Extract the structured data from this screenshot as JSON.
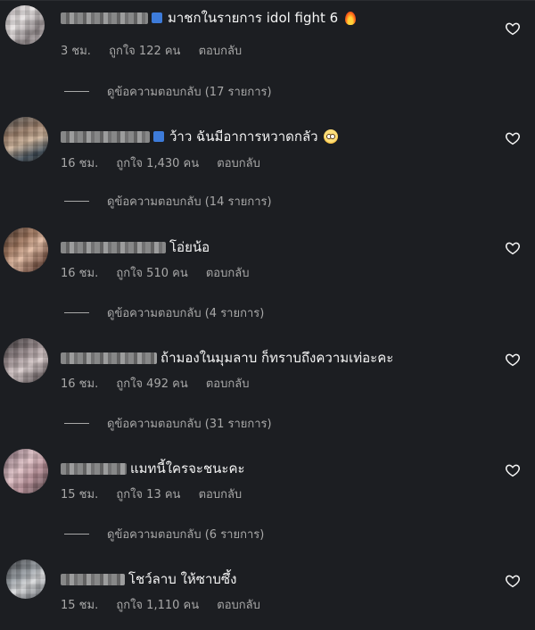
{
  "comments": [
    {
      "text": "มาชกในรายการ idol fight 6",
      "time": "3 ชม.",
      "likes": "ถูกใจ 122 คน",
      "reply": "ตอบกลับ",
      "view_replies": "ดูข้อความตอบกลับ (17 รายการ)",
      "emoji": "fire-icon"
    },
    {
      "text": "ว้าว ฉันมีอาการหวาดกลัว",
      "time": "16 ชม.",
      "likes": "ถูกใจ 1,430 คน",
      "reply": "ตอบกลับ",
      "view_replies": "ดูข้อความตอบกลับ (14 รายการ)",
      "emoji": "flushed-face-icon"
    },
    {
      "text": "โอ่ยน้อ",
      "time": "16 ชม.",
      "likes": "ถูกใจ 510 คน",
      "reply": "ตอบกลับ",
      "view_replies": "ดูข้อความตอบกลับ (4 รายการ)"
    },
    {
      "text": "ถ้ามองในมุมลาบ ก็ทราบถึงความเท่อะคะ",
      "time": "16 ชม.",
      "likes": "ถูกใจ 492 คน",
      "reply": "ตอบกลับ",
      "view_replies": "ดูข้อความตอบกลับ (31 รายการ)"
    },
    {
      "text": "แมทนี้ใครจะชนะคะ",
      "time": "15 ชม.",
      "likes": "ถูกใจ 13 คน",
      "reply": "ตอบกลับ",
      "view_replies": "ดูข้อความตอบกลับ (6 รายการ)"
    },
    {
      "text": "โชว์ลาบ ให้ซาบซึ้ง",
      "time": "15 ชม.",
      "likes": "ถูกใจ 1,110 คน",
      "reply": "ตอบกลับ"
    }
  ],
  "colors": {
    "background": "#1c1e22",
    "primary_text": "#f5f5f5",
    "secondary_text": "#a8a8a8"
  }
}
